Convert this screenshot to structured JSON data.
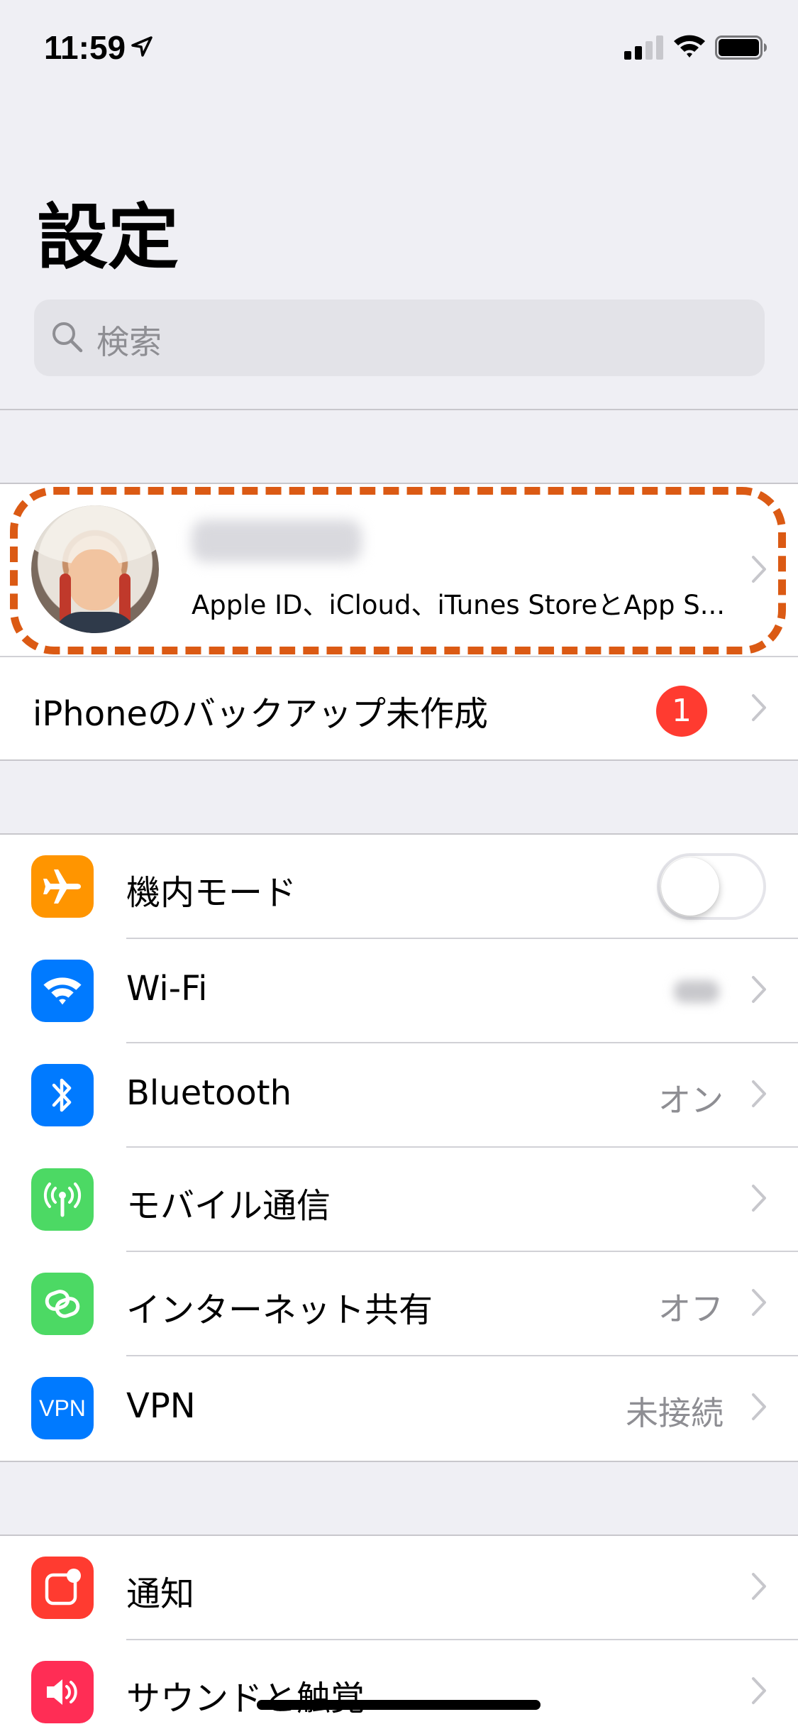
{
  "status_bar": {
    "time": "11:59",
    "icons": [
      "location-arrow-icon",
      "cellular-signal-icon",
      "wifi-icon",
      "battery-icon"
    ]
  },
  "header": {
    "title": "設定",
    "search_placeholder": "検索"
  },
  "profile": {
    "subtitle": "Apple ID、iCloud、iTunes StoreとApp S..."
  },
  "backup_row": {
    "label": "iPhoneのバックアップ未作成",
    "badge": "1"
  },
  "connectivity": [
    {
      "id": "airplane",
      "label": "機内モード",
      "icon": "airplane-icon",
      "color": "#ff9500",
      "toggle_on": false
    },
    {
      "id": "wifi",
      "label": "Wi-Fi",
      "icon": "wifi-icon",
      "color": "#007aff",
      "value": ""
    },
    {
      "id": "bluetooth",
      "label": "Bluetooth",
      "icon": "bluetooth-icon",
      "color": "#007aff",
      "value": "オン"
    },
    {
      "id": "cellular",
      "label": "モバイル通信",
      "icon": "cellular-antenna-icon",
      "color": "#4cd964",
      "value": ""
    },
    {
      "id": "hotspot",
      "label": "インターネット共有",
      "icon": "hotspot-icon",
      "color": "#4cd964",
      "value": "オフ"
    },
    {
      "id": "vpn",
      "label": "VPN",
      "icon": "vpn-icon",
      "color": "#007aff",
      "icon_text": "VPN",
      "value": "未接続"
    }
  ],
  "notifications_section": [
    {
      "id": "notifications",
      "label": "通知",
      "icon": "notifications-icon",
      "color": "#ff3b30"
    },
    {
      "id": "sounds",
      "label": "サウンドと触覚",
      "icon": "speaker-icon",
      "color": "#ff2d55"
    }
  ],
  "colors": {
    "background": "#efeff4",
    "highlight_dash": "#db5a14",
    "badge": "#ff3b30",
    "secondary_text": "#8e8e93"
  }
}
